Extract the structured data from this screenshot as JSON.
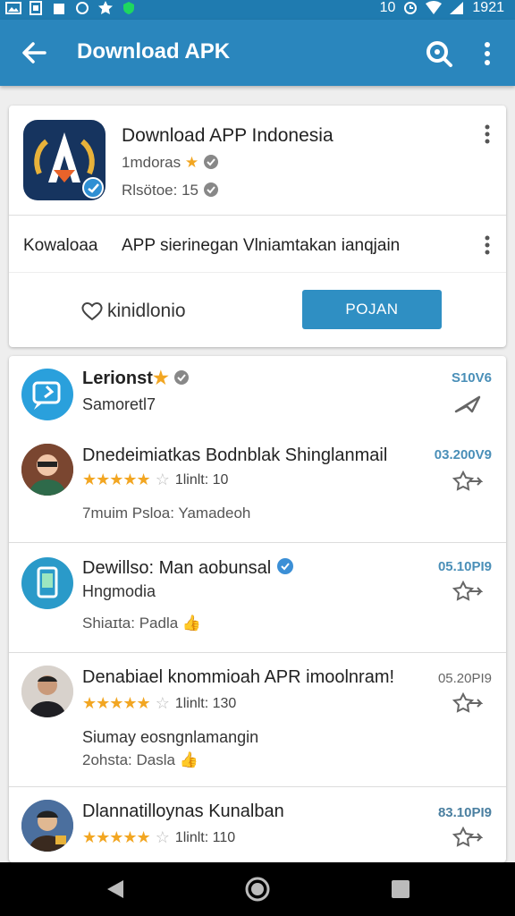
{
  "status_bar": {
    "right_text": "10",
    "time": "1921"
  },
  "app_bar": {
    "title": "Download APK"
  },
  "app_card": {
    "name": "Download APP Indonesia",
    "developer": "1mdoras",
    "release": "Rlsötoe: 15",
    "desc_label": "Kowaloaa",
    "desc_text": "APP sierinegan Vlniamtakan ianqjain",
    "publisher": "kinidlonio",
    "install_label": "POJAN"
  },
  "list": [
    {
      "title": "Lerionst",
      "subtitle": "Samoretl7",
      "time": "S10V6",
      "meta": ""
    },
    {
      "title": "Dnedeimiatkas Bodnblak Shinglanmail",
      "rating": "1linlt: 10",
      "meta": "7muim Psloa: Yamadeoh",
      "time": "03.200V9"
    },
    {
      "title": "Dewillso: Man aobunsal",
      "subtitle": "Hngmodia",
      "meta": "Shiaɪta: Padla",
      "time": "05.10PI9"
    },
    {
      "title": "Denabiael knommioah APR imoolnram!",
      "rating": "1linlt: 130",
      "subtitle": "Siumay eosngnlamangin",
      "meta": "2ohsta: Dasla",
      "time": "05.20PI9"
    },
    {
      "title": "Dlannatilloynas Kunalban",
      "rating": "1linlt: 110",
      "time": "83.10PI9"
    }
  ],
  "colors": {
    "primary": "#2a86bd",
    "status": "#1f7bb0",
    "button": "#2f8fc3",
    "star": "#f2a622"
  }
}
